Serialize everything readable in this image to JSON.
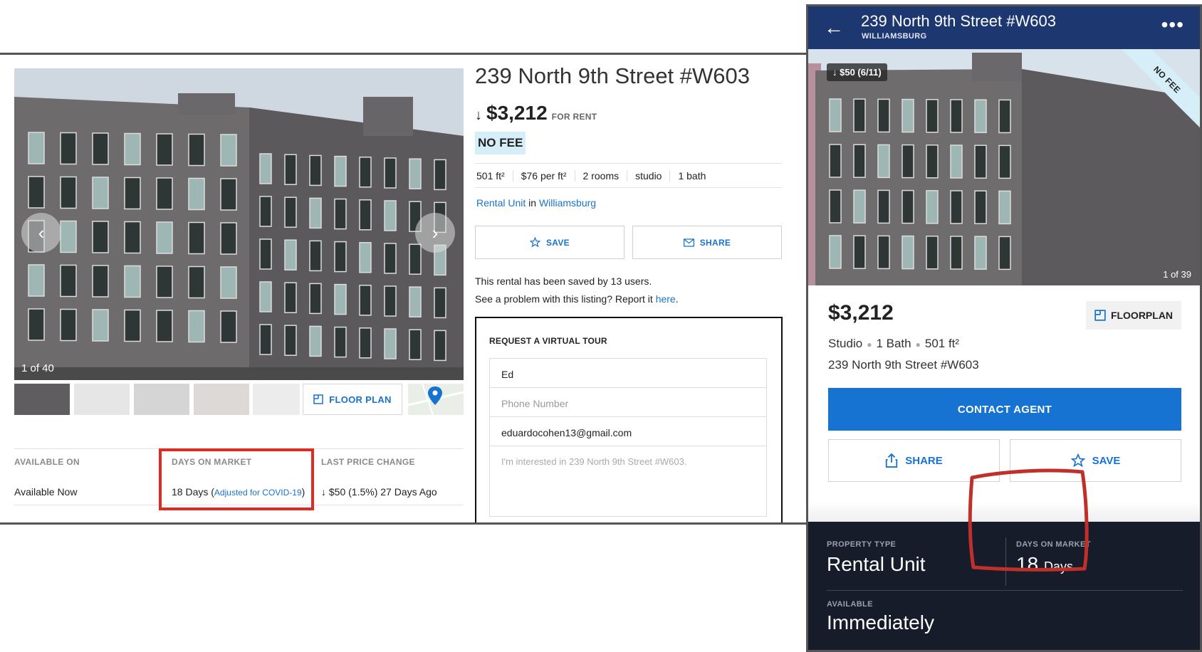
{
  "desktop": {
    "photo_count": "1 of 40",
    "floor_plan_label": "FLOOR PLAN",
    "title": "239 North 9th Street #W603",
    "price": "$3,212",
    "price_arrow": "↓",
    "price_suffix": "FOR RENT",
    "no_fee": "NO FEE",
    "facts": [
      "501 ft²",
      "$76 per ft²",
      "2 rooms",
      "studio",
      "1 bath"
    ],
    "unit_type": "Rental Unit",
    "unit_in": "in",
    "neighborhood": "Williamsburg",
    "save_label": "SAVE",
    "share_label": "SHARE",
    "saved_note": "This rental has been saved by 13 users.",
    "report_text": "See a problem with this listing? Report it",
    "report_link": "here",
    "report_period": ".",
    "tour": {
      "title": "REQUEST A VIRTUAL TOUR",
      "name_value": "Ed",
      "phone_placeholder": "Phone Number",
      "email_value": "eduardocohen13@gmail.com",
      "message_placeholder": "I'm interested in 239 North 9th Street #W603."
    },
    "stats": {
      "available_label": "AVAILABLE ON",
      "available_value": "Available Now",
      "dom_label": "DAYS ON MARKET",
      "dom_value": "18 Days",
      "dom_open": "(",
      "dom_link": "Adjusted for COVID-19",
      "dom_close": ")",
      "price_change_label": "LAST PRICE CHANGE",
      "price_change_value": "↓ $50 (1.5%) 27 Days Ago"
    }
  },
  "mobile": {
    "back_icon": "←",
    "title": "239 North 9th Street #W603",
    "subtitle": "WILLIAMSBURG",
    "more_icon": "•••",
    "price_drop_badge": "↓ $50 (6/11)",
    "no_fee_band": "NO FEE",
    "photo_count": "1 of 39",
    "price": "$3,212",
    "floorplan_label": "FLOORPLAN",
    "facts": [
      "Studio",
      "1 Bath",
      "501 ft²"
    ],
    "address": "239 North 9th Street #W603",
    "contact_label": "CONTACT AGENT",
    "share_label": "SHARE",
    "save_label": "SAVE",
    "property_type_label": "PROPERTY TYPE",
    "property_type_value": "Rental Unit",
    "dom_label": "DAYS ON MARKET",
    "dom_number": "18",
    "dom_unit": "Days",
    "available_label": "AVAILABLE",
    "available_value": "Immediately"
  },
  "colors": {
    "link_blue": "#1a73c9",
    "header_navy": "#1d3770",
    "highlight_red": "#e02a21",
    "no_fee_bg": "#d6eef8"
  }
}
